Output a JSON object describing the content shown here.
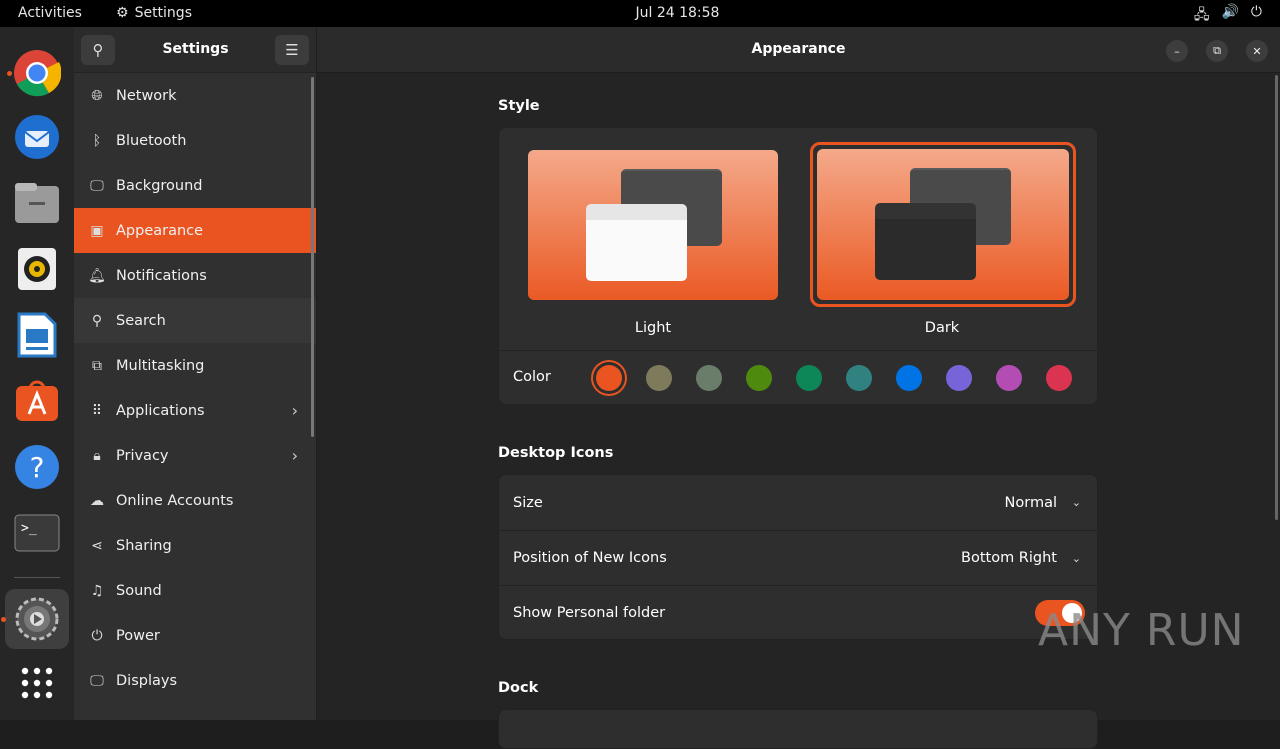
{
  "topbar": {
    "activities": "Activities",
    "app_name": "Settings",
    "datetime": "Jul 24  18:58",
    "tray_icons": [
      "network-icon",
      "volume-icon",
      "power-icon"
    ]
  },
  "dock": {
    "items": [
      "chrome",
      "thunderbird",
      "files",
      "rhythmbox",
      "libreoffice-writer",
      "app-center",
      "help",
      "terminal",
      "settings",
      "show-apps"
    ],
    "running": [
      "chrome",
      "settings"
    ],
    "active": "settings"
  },
  "sidebar": {
    "title": "Settings",
    "items": [
      {
        "label": "Network",
        "icon": "globe-icon"
      },
      {
        "label": "Bluetooth",
        "icon": "bluetooth-icon"
      },
      {
        "label": "Background",
        "icon": "monitor-icon"
      },
      {
        "label": "Appearance",
        "icon": "appearance-icon",
        "selected": true
      },
      {
        "label": "Notifications",
        "icon": "bell-icon"
      },
      {
        "label": "Search",
        "icon": "search-icon"
      },
      {
        "label": "Multitasking",
        "icon": "multitasking-icon"
      },
      {
        "label": "Applications",
        "icon": "grid-icon",
        "has_submenu": true
      },
      {
        "label": "Privacy",
        "icon": "lock-icon",
        "has_submenu": true
      },
      {
        "label": "Online Accounts",
        "icon": "cloud-icon"
      },
      {
        "label": "Sharing",
        "icon": "share-icon"
      },
      {
        "label": "Sound",
        "icon": "music-note-icon"
      },
      {
        "label": "Power",
        "icon": "power-icon"
      },
      {
        "label": "Displays",
        "icon": "display-icon"
      }
    ]
  },
  "main": {
    "title": "Appearance",
    "style": {
      "heading": "Style",
      "options": [
        {
          "label": "Light"
        },
        {
          "label": "Dark",
          "selected": true
        }
      ],
      "color_label": "Color",
      "colors": [
        "#e95420",
        "#7e7a5c",
        "#6a7d6a",
        "#4e8a0e",
        "#0d8658",
        "#308280",
        "#0073e5",
        "#7764d8",
        "#b34cb3",
        "#da3450"
      ],
      "selected_color": "#e95420"
    },
    "desktop_icons": {
      "heading": "Desktop Icons",
      "size_label": "Size",
      "size_value": "Normal",
      "position_label": "Position of New Icons",
      "position_value": "Bottom Right",
      "personal_label": "Show Personal folder",
      "personal_on": true
    },
    "dock": {
      "heading": "Dock"
    }
  },
  "watermark": "ANY RUN"
}
